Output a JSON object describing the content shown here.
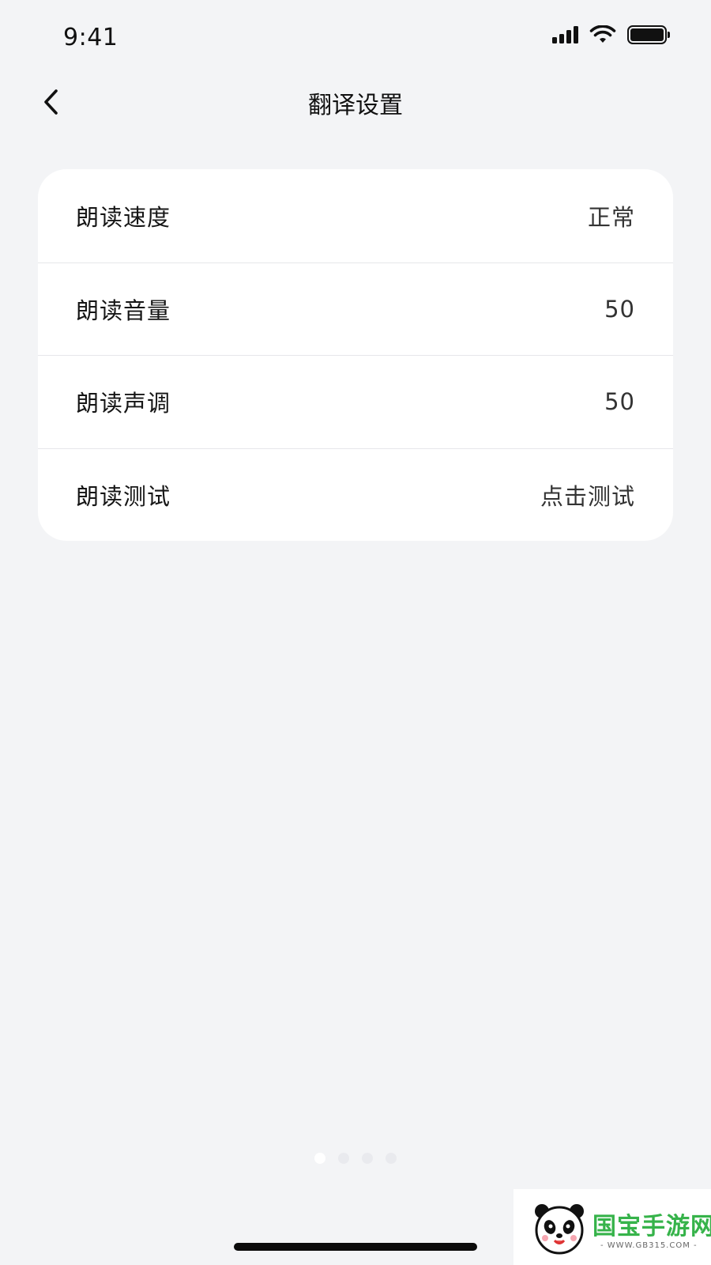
{
  "status_bar": {
    "time": "9:41"
  },
  "nav": {
    "title": "翻译设置"
  },
  "settings": [
    {
      "label": "朗读速度",
      "value": "正常"
    },
    {
      "label": "朗读音量",
      "value": "50"
    },
    {
      "label": "朗读声调",
      "value": "50"
    },
    {
      "label": "朗读测试",
      "value": "点击测试"
    }
  ],
  "watermark": {
    "brand": "国宝手游网",
    "url": "- WWW.GB315.COM -"
  },
  "colors": {
    "background": "#f3f4f6",
    "card": "#ffffff",
    "text": "#161616",
    "watermark_green": "#36b34a"
  },
  "icons": [
    "signal-icon",
    "wifi-icon",
    "battery-icon",
    "back-chevron-icon",
    "panda-logo-icon"
  ]
}
